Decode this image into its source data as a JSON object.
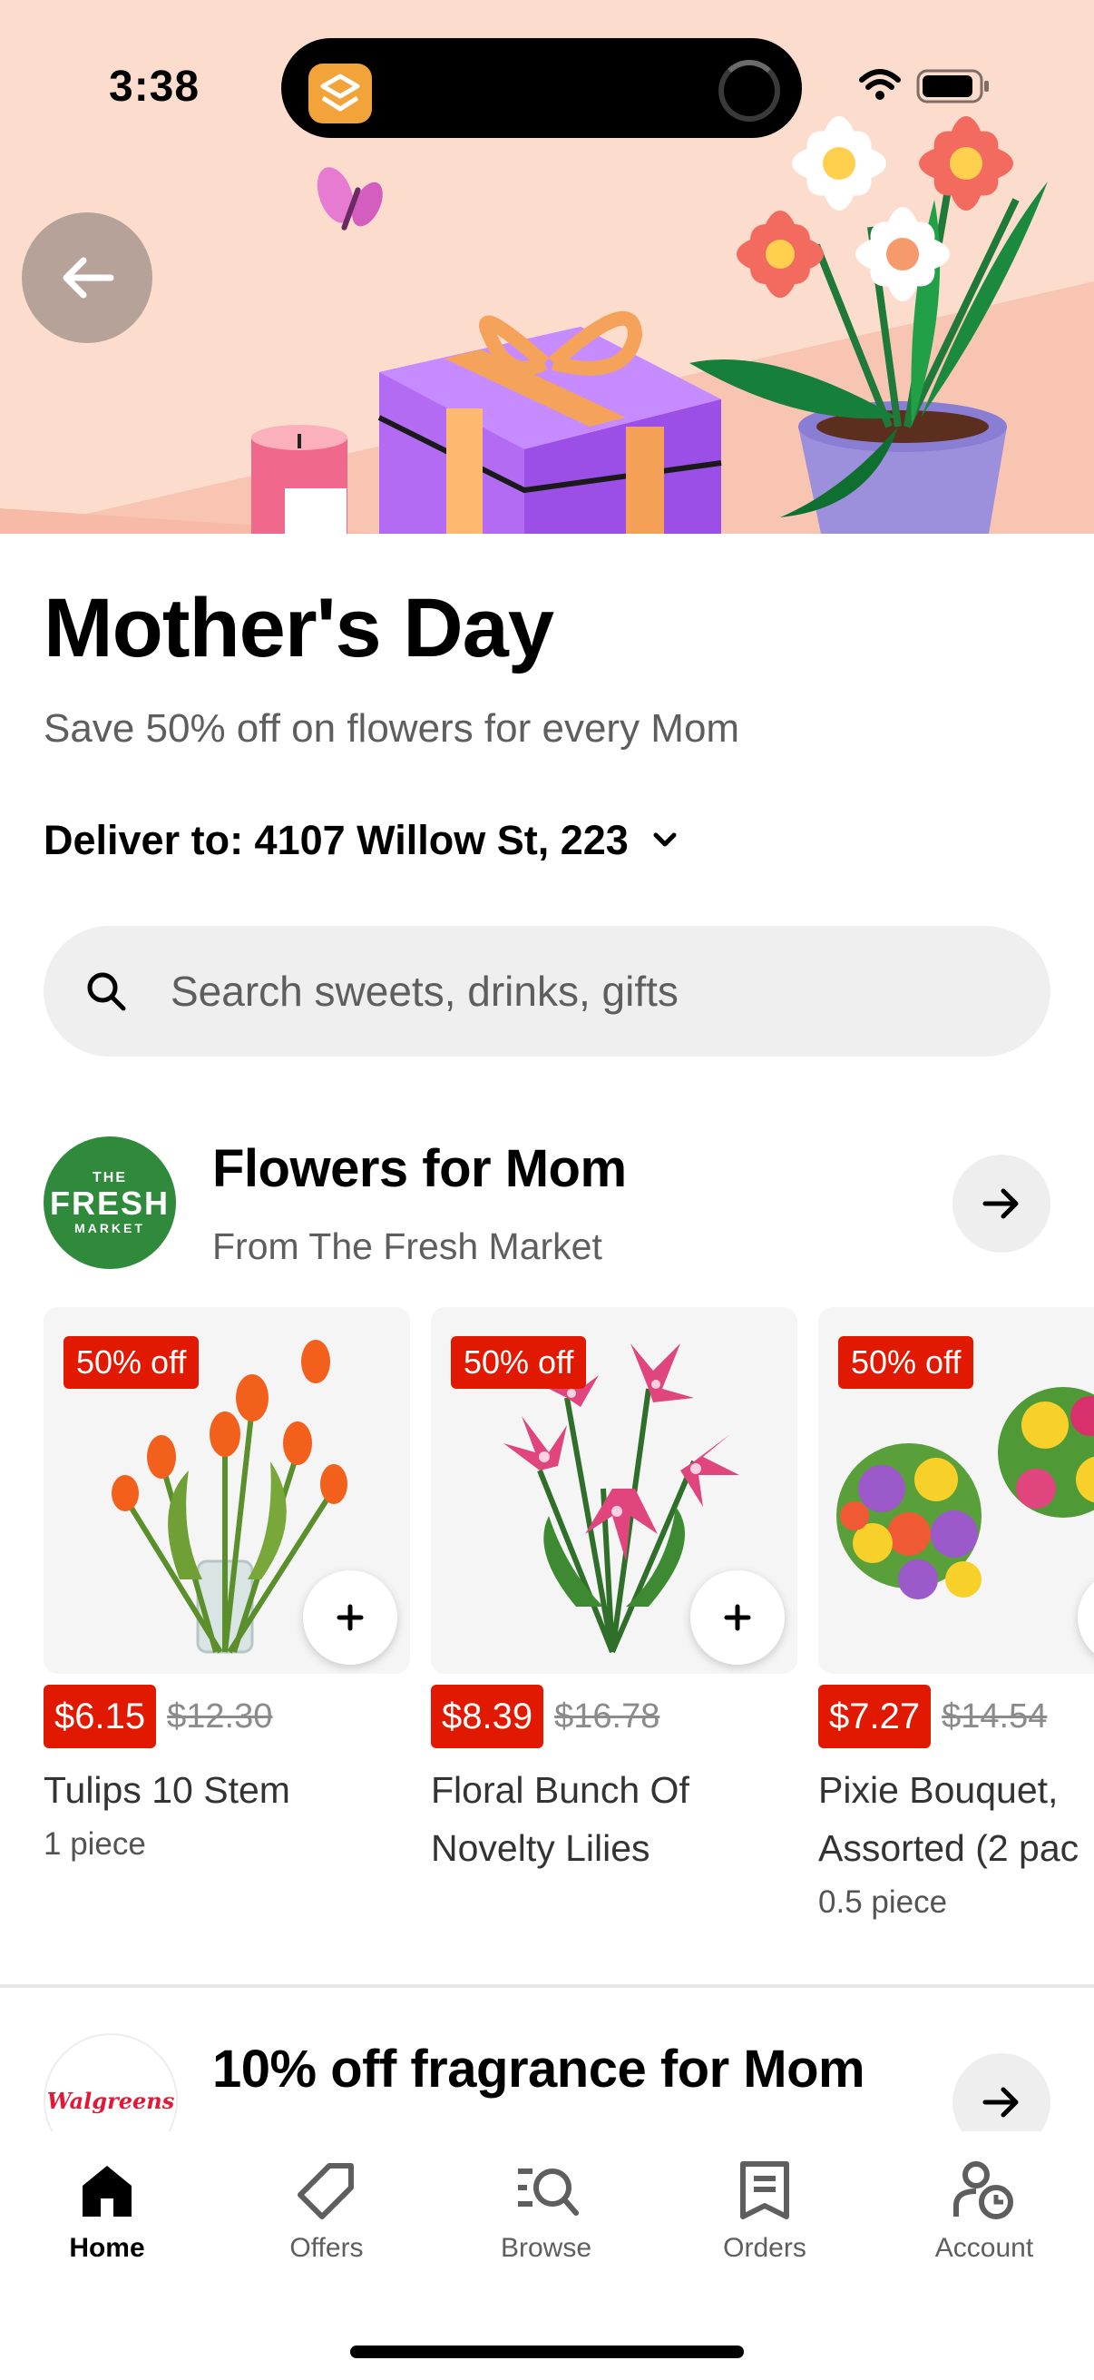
{
  "status_bar": {
    "time": "3:38"
  },
  "hero": {
    "back_label": "Back"
  },
  "page": {
    "title": "Mother's Day",
    "subtitle": "Save 50% off on flowers for every Mom",
    "deliver_to": "Deliver to: 4107 Willow St, 223"
  },
  "search": {
    "placeholder": "Search sweets, drinks, gifts"
  },
  "section1": {
    "logo": {
      "line1": "THE",
      "line2": "FRESH",
      "line3": "MARKET"
    },
    "title": "Flowers for Mom",
    "subtitle": "From The Fresh Market",
    "products": [
      {
        "badge": "50% off",
        "price": "$6.15",
        "original_price": "$12.30",
        "name_line1": "Tulips 10 Stem",
        "name_line2": "",
        "quantity": "1 piece"
      },
      {
        "badge": "50% off",
        "price": "$8.39",
        "original_price": "$16.78",
        "name_line1": "Floral Bunch Of",
        "name_line2": "Novelty Lilies",
        "quantity": ""
      },
      {
        "badge": "50% off",
        "price": "$7.27",
        "original_price": "$14.54",
        "name_line1": "Pixie Bouquet,",
        "name_line2": "Assorted (2 pac",
        "quantity": "0.5 piece"
      }
    ]
  },
  "section2": {
    "logo_text": "Walgreens",
    "title": "10% off fragrance for Mom"
  },
  "tabs": [
    {
      "label": "Home",
      "icon": "home-icon",
      "active": true
    },
    {
      "label": "Offers",
      "icon": "tag-icon",
      "active": false
    },
    {
      "label": "Browse",
      "icon": "browse-icon",
      "active": false
    },
    {
      "label": "Orders",
      "icon": "receipt-icon",
      "active": false
    },
    {
      "label": "Account",
      "icon": "account-icon",
      "active": false
    }
  ],
  "colors": {
    "accent_red": "#e11900",
    "hero_background": "#fcdccd",
    "fresh_market_green": "#2f8a3c"
  }
}
